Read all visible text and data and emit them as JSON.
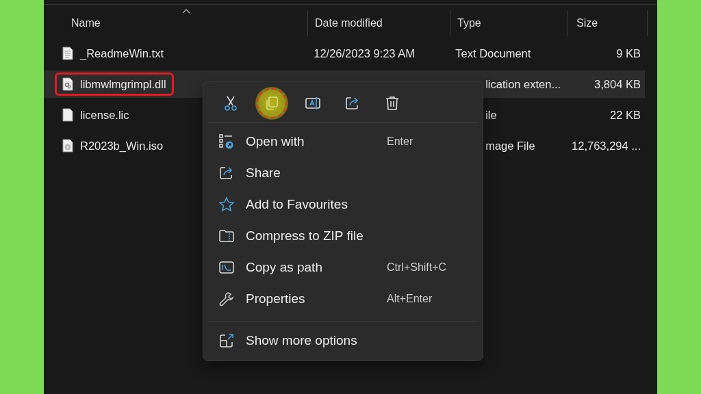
{
  "columns": [
    {
      "label": "Name",
      "sorted": true
    },
    {
      "label": "Date modified",
      "sorted": false
    },
    {
      "label": "Type",
      "sorted": false
    },
    {
      "label": "Size",
      "sorted": false
    }
  ],
  "files": [
    {
      "kind": "text",
      "name": "_ReadmeWin.txt",
      "date": "12/26/2023 9:23 AM",
      "type": "Text Document",
      "type_clipped": false,
      "size": "9 KB",
      "selected": false,
      "annotated": false
    },
    {
      "kind": "dll",
      "name": "libmwlmgrimpl.dll",
      "type": "lication exten...",
      "type_clipped": true,
      "size": "3,804 KB",
      "selected": true,
      "annotated": true
    },
    {
      "kind": "blank",
      "name": "license.lic",
      "type": "ile",
      "type_clipped": true,
      "size": "22 KB",
      "selected": false,
      "annotated": false
    },
    {
      "kind": "disc",
      "name": "R2023b_Win.iso",
      "type": "mage File",
      "type_clipped": true,
      "size": "12,763,294 ...",
      "selected": false,
      "annotated": false
    }
  ],
  "context_menu": {
    "actions": [
      {
        "kind": "cut",
        "highlighted": false
      },
      {
        "kind": "copy",
        "highlighted": true
      },
      {
        "kind": "rename",
        "highlighted": false
      },
      {
        "kind": "share",
        "highlighted": false
      },
      {
        "kind": "delete",
        "highlighted": false
      }
    ],
    "items": [
      {
        "kind": "open",
        "label": "Open with",
        "shortcut": "Enter"
      },
      {
        "kind": "share",
        "label": "Share"
      },
      {
        "kind": "star",
        "label": "Add to Favourites"
      },
      {
        "kind": "zip",
        "label": "Compress to ZIP file"
      },
      {
        "kind": "path",
        "label": "Copy as path",
        "shortcut": "Ctrl+Shift+C"
      },
      {
        "kind": "props",
        "label": "Properties",
        "shortcut": "Alt+Enter"
      }
    ],
    "more": {
      "kind": "more",
      "label": "Show more options"
    }
  }
}
